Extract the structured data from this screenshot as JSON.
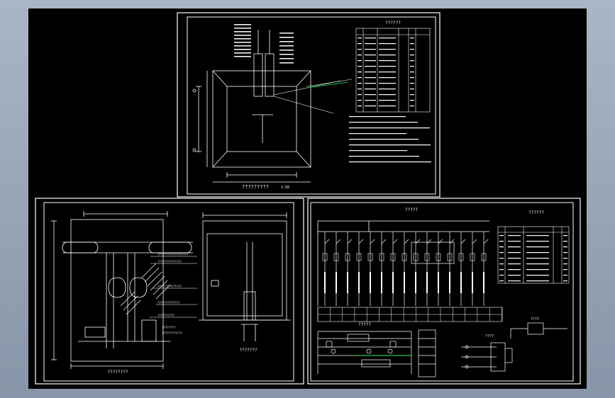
{
  "drawing_sheets": [
    {
      "id": "top",
      "title": "?????????",
      "scale_mark": "1:50",
      "table_title": "??????",
      "notes_lines": 9
    },
    {
      "id": "bottom-left",
      "section_title": "????????",
      "detail_title": "???????",
      "callout_notes": [
        "??????????????????",
        "??????????????",
        "??????????????",
        "?????????????",
        "??????????",
        "????????",
        "????????????"
      ]
    },
    {
      "id": "bottom-right",
      "diagram_title": "?????",
      "table_title": "??????",
      "control_title": "?????",
      "side_title": "????",
      "small_title": "????"
    }
  ],
  "colors": {
    "frame": "#ffffff",
    "text": "#ffffff",
    "accent_green": "#00ff66",
    "accent_cyan": "#33ffee",
    "accent_red": "#ff3333",
    "background": "#000000"
  }
}
